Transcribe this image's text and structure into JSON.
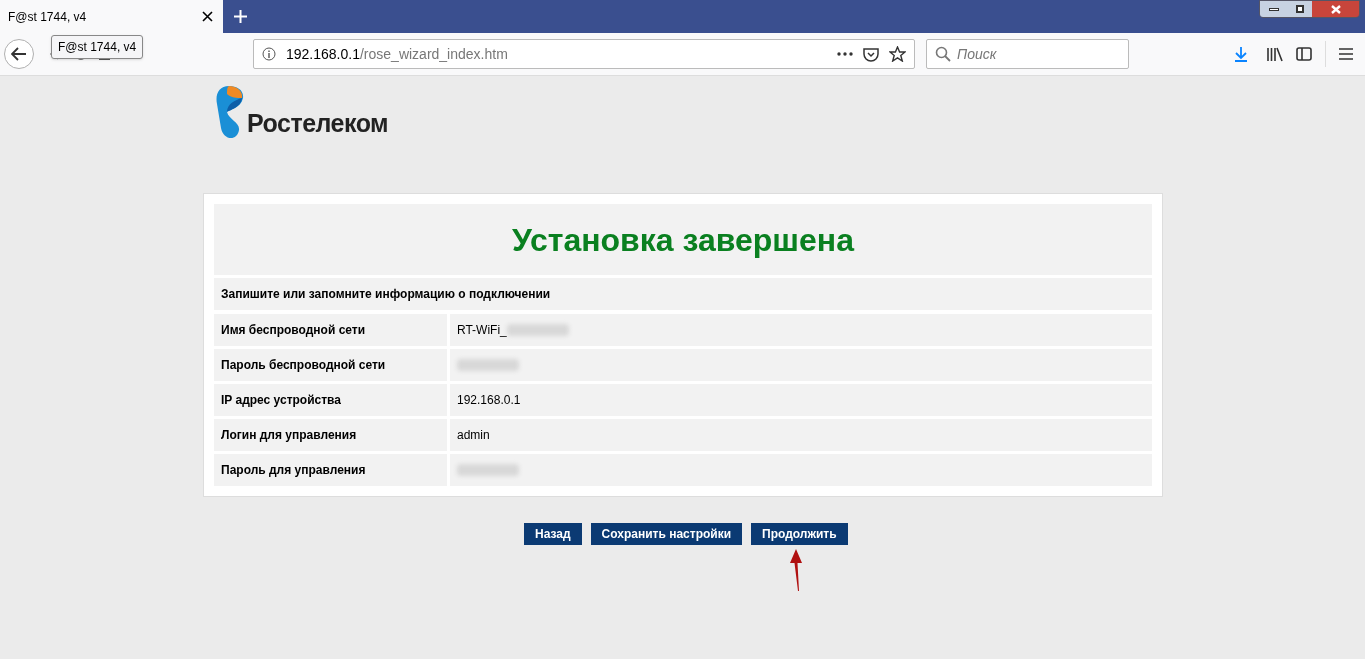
{
  "browser": {
    "tab": {
      "title": "F@st 1744, v4",
      "selected": true
    },
    "tooltip": "F@st 1744, v4",
    "address": {
      "host": "192.168.0.1",
      "path": "/rose_wizard_index.htm"
    },
    "search": {
      "placeholder": "Поиск"
    }
  },
  "logo": {
    "text": "Ростелеком"
  },
  "panel": {
    "title": "Установка завершена",
    "subtitle": "Запишите или запомните информацию о подключении",
    "rows": [
      {
        "label": "Имя беспроводной сети",
        "value": "RT-WiFi_",
        "blurred": true
      },
      {
        "label": "Пароль беспроводной сети",
        "blurred": true
      },
      {
        "label": "IP адрес устройства",
        "value": "192.168.0.1",
        "blurred": false
      },
      {
        "label": "Логин для управления",
        "value": "admin",
        "blurred": false
      },
      {
        "label": "Пароль для управления",
        "blurred": true
      }
    ]
  },
  "buttons": [
    {
      "label": "Назад"
    },
    {
      "label": "Сохранить настройки"
    },
    {
      "label": "Продолжить"
    }
  ]
}
